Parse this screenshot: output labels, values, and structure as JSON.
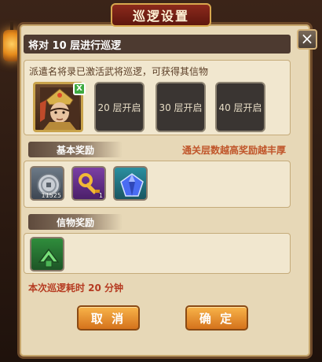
{
  "dialog": {
    "title": "巡逻设置",
    "layer_header": "将对 10 层进行巡逻",
    "dispatch_text": "派遣名将录已激活武将巡逻，可获得其信物",
    "hero_badge": "X",
    "locked_slots": [
      "20 层开启",
      "30 层开启",
      "40 层开启"
    ],
    "basic_reward_label": "基本奖励",
    "reward_hint": "通关层数越高奖励越丰厚",
    "basic_rewards": [
      {
        "icon": "silver-coin-icon",
        "qty": "11525"
      },
      {
        "icon": "golden-key-icon",
        "qty": "1"
      },
      {
        "icon": "blue-gem-icon",
        "qty": ""
      }
    ],
    "token_reward_label": "信物奖励",
    "token_rewards": [
      {
        "icon": "jade-relic-icon"
      }
    ],
    "duration_text": "本次巡逻耗时 20 分钟",
    "cancel_label": "取 消",
    "confirm_label": "确 定"
  }
}
